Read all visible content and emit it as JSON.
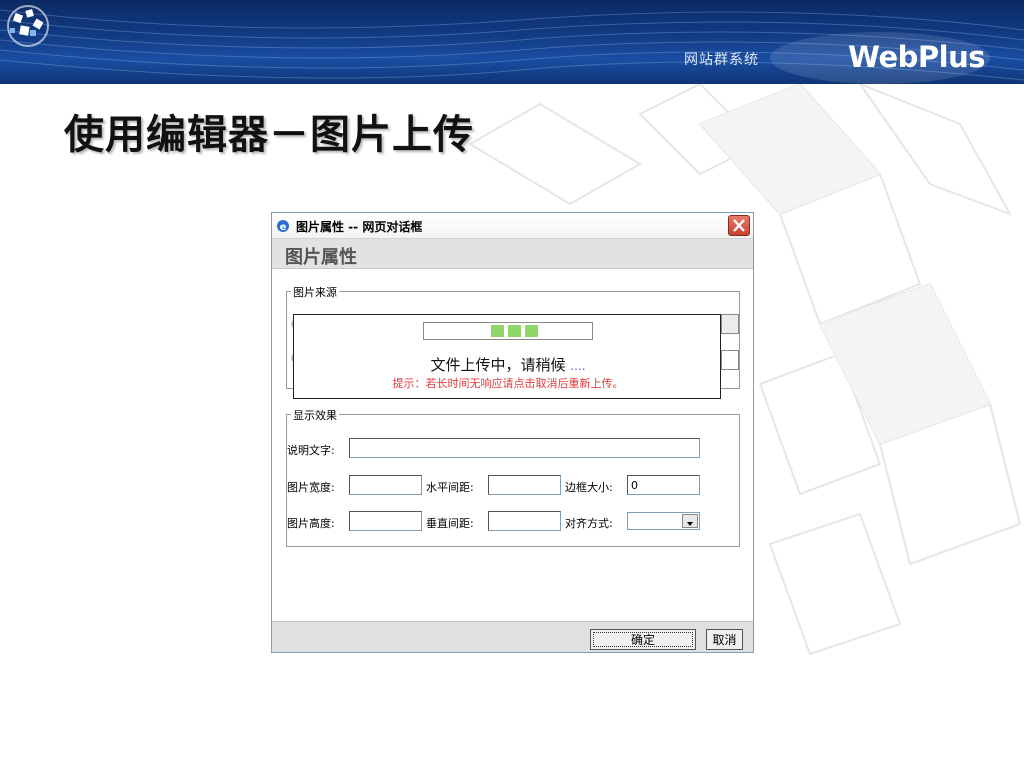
{
  "banner": {
    "subtitle": "网站群系统",
    "logo_text": "WebPlus",
    "logo_icon": "webplus-logo-icon"
  },
  "slide": {
    "title": "使用编辑器－图片上传"
  },
  "dialog": {
    "title": "图片属性 -- 网页对话框",
    "icon": "ie-icon",
    "header": "图片属性",
    "source_group": {
      "legend": "图片来源"
    },
    "display_group": {
      "legend": "显示效果",
      "caption_label": "说明文字:",
      "caption_value": "",
      "width_label": "图片宽度:",
      "width_value": "",
      "hspace_label": "水平间距:",
      "hspace_value": "",
      "border_label": "边框大小:",
      "border_value": "0",
      "height_label": "图片高度:",
      "height_value": "",
      "vspace_label": "垂直间距:",
      "vspace_value": "",
      "align_label": "对齐方式:",
      "align_value": ""
    },
    "buttons": {
      "ok": "确定",
      "cancel": "取消"
    }
  },
  "upload": {
    "progress_segments": 3,
    "message": "文件上传中，请稍候",
    "dots": "....",
    "hint": "提示：若长时间无响应请点击取消后重新上传。",
    "bar_color": "#8fd66b"
  },
  "colors": {
    "banner_dark": "#0b2a63",
    "hint_red": "#e23a3a"
  }
}
